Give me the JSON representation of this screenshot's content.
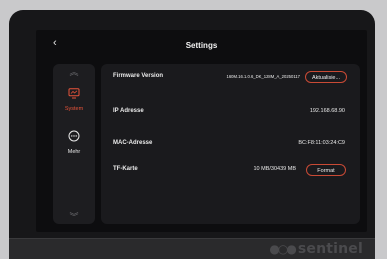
{
  "screen": {
    "back_icon": "chevron-left-icon",
    "title": "Settings"
  },
  "sidebar": {
    "items": [
      {
        "label": "System",
        "icon": "monitor-icon",
        "active": true
      },
      {
        "label": "Mehr",
        "icon": "more-dots-icon",
        "active": false
      }
    ]
  },
  "settings": {
    "firmware": {
      "label": "Firmware Version",
      "value": "160M.16.1.0.6_DK_128M_A_20250117",
      "button": "Aktualisie..."
    },
    "ip": {
      "label": "IP Adresse",
      "value": "192.168.68.90"
    },
    "mac": {
      "label": "MAC-Adresse",
      "value": "BC:F8:11:03:24:C9"
    },
    "tf": {
      "label": "TF-Karte",
      "value": "10 MB/30439 MB",
      "button": "Format"
    }
  },
  "device": {
    "brand": "sentinel"
  },
  "colors": {
    "accent": "#e8543a",
    "panel": "#1a1a1d",
    "background": "#0d0d0f"
  }
}
